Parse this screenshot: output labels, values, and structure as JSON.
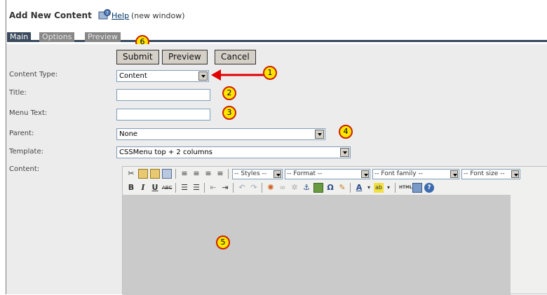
{
  "header": {
    "title": "Add New Content",
    "help_link": "Help",
    "help_note": "(new window)",
    "help_icon": "help-icon"
  },
  "tabs": [
    {
      "label": "Main",
      "active": true
    },
    {
      "label": "Options",
      "active": false
    },
    {
      "label": "Preview",
      "active": false
    }
  ],
  "buttons": {
    "submit": "Submit",
    "preview": "Preview",
    "cancel": "Cancel"
  },
  "form": {
    "content_type": {
      "label": "Content Type:",
      "value": "Content"
    },
    "title": {
      "label": "Title:",
      "value": ""
    },
    "menu_text": {
      "label": "Menu Text:",
      "value": ""
    },
    "parent": {
      "label": "Parent:",
      "value": "None"
    },
    "template": {
      "label": "Template:",
      "value": "CSSMenu top + 2 columns"
    },
    "content": {
      "label": "Content:"
    }
  },
  "editor_toolbar": {
    "styles": "-- Styles --",
    "format": "-- Format --",
    "font_family": "-- Font family --",
    "font_size": "-- Font size --"
  },
  "markers": [
    "1",
    "2",
    "3",
    "4",
    "5",
    "6"
  ],
  "colors": {
    "tab_active": "#3b4a5e",
    "tab_inactive": "#888888",
    "marker_fill": "#ffe500",
    "marker_border": "#cc2200",
    "arrow": "#e00000"
  }
}
